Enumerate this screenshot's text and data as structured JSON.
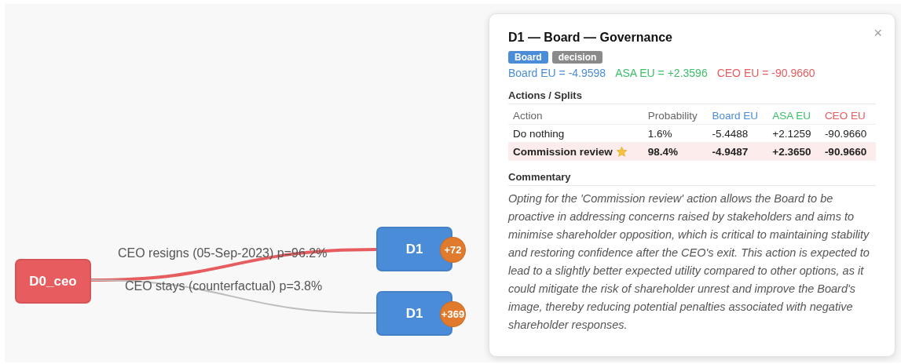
{
  "graph": {
    "nodes": [
      {
        "label": "D0_ceo",
        "color": "#e65c5f"
      },
      {
        "label": "D1",
        "color": "#4a8cd8",
        "badge": "+72"
      },
      {
        "label": "D1",
        "color": "#4a8cd8",
        "badge": "+369"
      }
    ],
    "edges": [
      {
        "label": "CEO resigns (05-Sep-2023) p=96.2%",
        "highlighted": true
      },
      {
        "label": "CEO stays (counterfactual) p=3.8%",
        "highlighted": false
      }
    ]
  },
  "panel": {
    "title": "D1 — Board — Governance",
    "close": "×",
    "tags": [
      {
        "label": "Board",
        "color": "#4a8cd8"
      },
      {
        "label": "decision",
        "color": "#8a8a8a"
      }
    ],
    "eu_summary": [
      {
        "text": "Board EU = -4.9598",
        "color": "#4a8cd8"
      },
      {
        "text": "ASA EU = +2.3596",
        "color": "#3cc06a"
      },
      {
        "text": "CEO EU = -90.9660",
        "color": "#e65c5f"
      }
    ],
    "actions_heading": "Actions / Splits",
    "table": {
      "columns": [
        {
          "label": "Action",
          "color": "#666666"
        },
        {
          "label": "Probability",
          "color": "#666666"
        },
        {
          "label": "Board EU",
          "color": "#4a8cd8"
        },
        {
          "label": "ASA EU",
          "color": "#3cc06a"
        },
        {
          "label": "CEO EU",
          "color": "#e65c5f"
        }
      ],
      "rows": [
        {
          "cells": [
            "Do nothing",
            "1.6%",
            "-5.4488",
            "+2.1259",
            "-90.9660"
          ],
          "selected": false
        },
        {
          "cells": [
            "Commission review",
            "98.4%",
            "-4.9487",
            "+2.3650",
            "-90.9660"
          ],
          "selected": true
        }
      ]
    },
    "commentary_heading": "Commentary",
    "commentary": "Opting for the 'Commission review' action allows the Board to be proactive in addressing concerns raised by stakeholders and aims to minimise shareholder opposition, which is critical to maintaining stability and restoring confidence after the CEO's exit. This action is expected to lead to a slightly better expected utility compared to other options, as it could mitigate the risk of shareholder unrest and improve the Board's image, thereby reducing potential penalties associated with negative shareholder responses."
  }
}
